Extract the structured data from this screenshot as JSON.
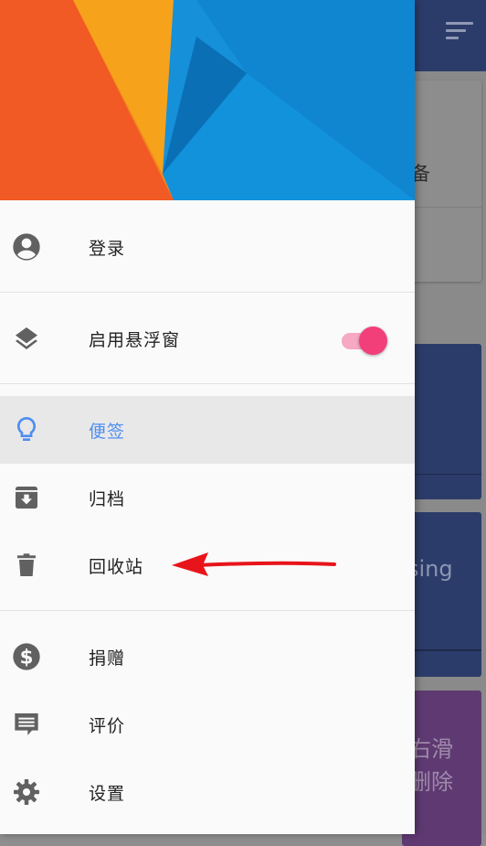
{
  "background": {
    "card1_text": "备",
    "card3_text": "sing",
    "card4_line1": "右滑",
    "card4_line2": "删除"
  },
  "drawer": {
    "items": [
      {
        "label": "登录",
        "icon": "account-circle-icon"
      },
      {
        "label": "启用悬浮窗",
        "icon": "layers-icon"
      },
      {
        "label": "便签",
        "icon": "lightbulb-icon"
      },
      {
        "label": "归档",
        "icon": "archive-icon"
      },
      {
        "label": "回收站",
        "icon": "trash-icon"
      },
      {
        "label": "捐赠",
        "icon": "dollar-circle-icon"
      },
      {
        "label": "评价",
        "icon": "comment-icon"
      },
      {
        "label": "设置",
        "icon": "gear-icon"
      }
    ],
    "active_item": "便签",
    "float_window_enabled": true
  },
  "colors": {
    "accent_blue": "#4f8ef2",
    "toggle_pink": "#f23f7a",
    "arrow_red": "#e8141b",
    "toolbar_navy": "#2c3c6a"
  }
}
